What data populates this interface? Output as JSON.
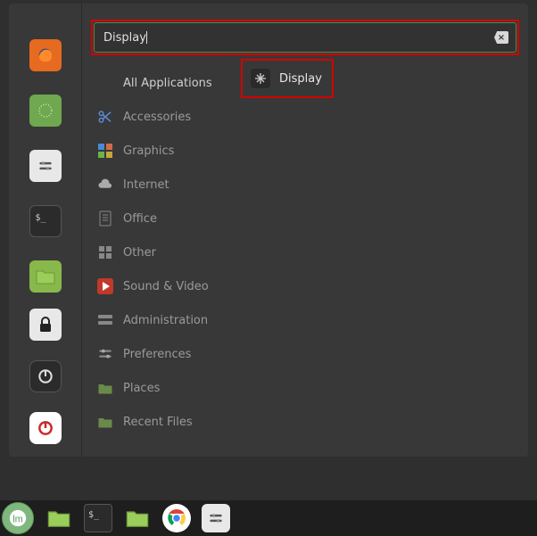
{
  "search": {
    "value": "Display",
    "clear_label": "×"
  },
  "categories": [
    {
      "label": "All Applications",
      "icon": "none"
    },
    {
      "label": "Accessories",
      "icon": "scissors"
    },
    {
      "label": "Graphics",
      "icon": "graphics"
    },
    {
      "label": "Internet",
      "icon": "cloud"
    },
    {
      "label": "Office",
      "icon": "office"
    },
    {
      "label": "Other",
      "icon": "grid"
    },
    {
      "label": "Sound & Video",
      "icon": "play"
    },
    {
      "label": "Administration",
      "icon": "admin"
    },
    {
      "label": "Preferences",
      "icon": "prefs"
    },
    {
      "label": "Places",
      "icon": "folder"
    },
    {
      "label": "Recent Files",
      "icon": "folder"
    }
  ],
  "results": [
    {
      "label": "Display",
      "icon": "display"
    }
  ],
  "favourites": [
    {
      "name": "firefox",
      "color": "#e66a1f"
    },
    {
      "name": "software-manager",
      "color": "#6fa84f"
    },
    {
      "name": "system-settings",
      "color": "#e8e8e8"
    },
    {
      "name": "terminal",
      "color": "#2b2b2b"
    },
    {
      "name": "files",
      "color": "#88b84b"
    }
  ],
  "fav_bottom": [
    {
      "name": "lock",
      "color": "#e8e8e8"
    },
    {
      "name": "logout",
      "color": "#2b2b2b"
    },
    {
      "name": "shutdown",
      "color": "#c92a2a"
    }
  ],
  "taskbar": [
    {
      "name": "menu"
    },
    {
      "name": "show-desktop"
    },
    {
      "name": "terminal"
    },
    {
      "name": "files"
    },
    {
      "name": "chrome"
    },
    {
      "name": "system-settings"
    }
  ]
}
